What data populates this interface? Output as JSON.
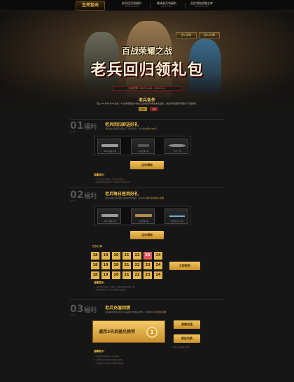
{
  "nav": {
    "logo": "生死狙击",
    "items": [
      {
        "label": "老兵回归领福利",
        "sub": "REGRESSION"
      },
      {
        "label": "邀请老兵领福利",
        "sub": "INVITATION"
      },
      {
        "label": "全民领取武器仓库",
        "sub": "WAREHOUSE"
      }
    ]
  },
  "hero": {
    "btn_login": "进入游戏",
    "btn_share": "加入QQ群",
    "title_small": "百战荣耀之战",
    "title_big": "老兵回归领礼包",
    "date": "活动时间: 2015.1.21 - 2015.2.2",
    "cond_title": "老兵条件",
    "cond_text": "截止2015年1月21日前，15天未登录且35级以上的老兵可参加本次活动，满足条件后即可领取以下奖励哦！",
    "btn_a": "登录",
    "btn_b": "注册"
  },
  "sec1": {
    "num": "01",
    "step": "STEP",
    "cat": "福利",
    "title": "老兵回归即送好礼",
    "sub_pre": "老兵回归后即可领取以下老兵礼包，共价值",
    "sub_hl": "价值1280元",
    "weapons": [
      "M4A1-黄金 7天",
      "沙漠之鹰 7天",
      "工兵铲 7天"
    ],
    "button": "点击领取",
    "tips_title": "温馨提示：",
    "tips": [
      "1. 每个账号仅可领取一次老兵回归礼包",
      "2. 领取后的物品将在24小时内发放至游戏仓库"
    ]
  },
  "sec2": {
    "num": "02",
    "step": "STEP",
    "cat": "福利",
    "title": "老兵每日签到好礼",
    "sub_pre": "回归后每日签到即可领取丰厚奖励，连续签到",
    "sub_hl": "即可获得永久武器",
    "weapons": [
      "AK47-黄金 3天",
      "沙漠之鹰 3天",
      "尼泊尔军刀 3天"
    ],
    "button": "点击领取",
    "cal_label": "签到日期",
    "cal_rows": [
      [
        "18",
        "19",
        "20",
        "21",
        "22",
        "23",
        "24"
      ],
      [
        "18",
        "19",
        "20",
        "21",
        "22",
        "23",
        "24"
      ],
      [
        "18",
        "19",
        "20",
        "21",
        "22",
        "23",
        "24"
      ]
    ],
    "today_label": "23",
    "signin": "立即签到",
    "tips_title": "温馨提示：",
    "tips": [
      "1. 每日签到可领取一次奖励，断签后需重新开始计算",
      "2. 签到奖励将在24小时内发放至游戏仓库"
    ]
  },
  "sec3": {
    "num": "03",
    "step": "STEP",
    "cat": "福利",
    "title": "老兵充值回馈",
    "sub_pre": "活动期间老兵充值可获得额外武器兑换券，兑换券可兑换",
    "sub_hl": "永久武器",
    "redeem_text": "通用3天武器兑换券",
    "redeem_count": "1",
    "btn_charge": "我要充值",
    "btn_exchange": "前往兑换",
    "small_note": "兑换后奖励将直接发放",
    "tips_title": "温馨提示：",
    "tips": [
      "1. 每充值10元可获得一张兑换券",
      "2. 兑换券可在活动页面兑换指定武器",
      "3. 活动结束后未使用的兑换券将被清空"
    ]
  }
}
